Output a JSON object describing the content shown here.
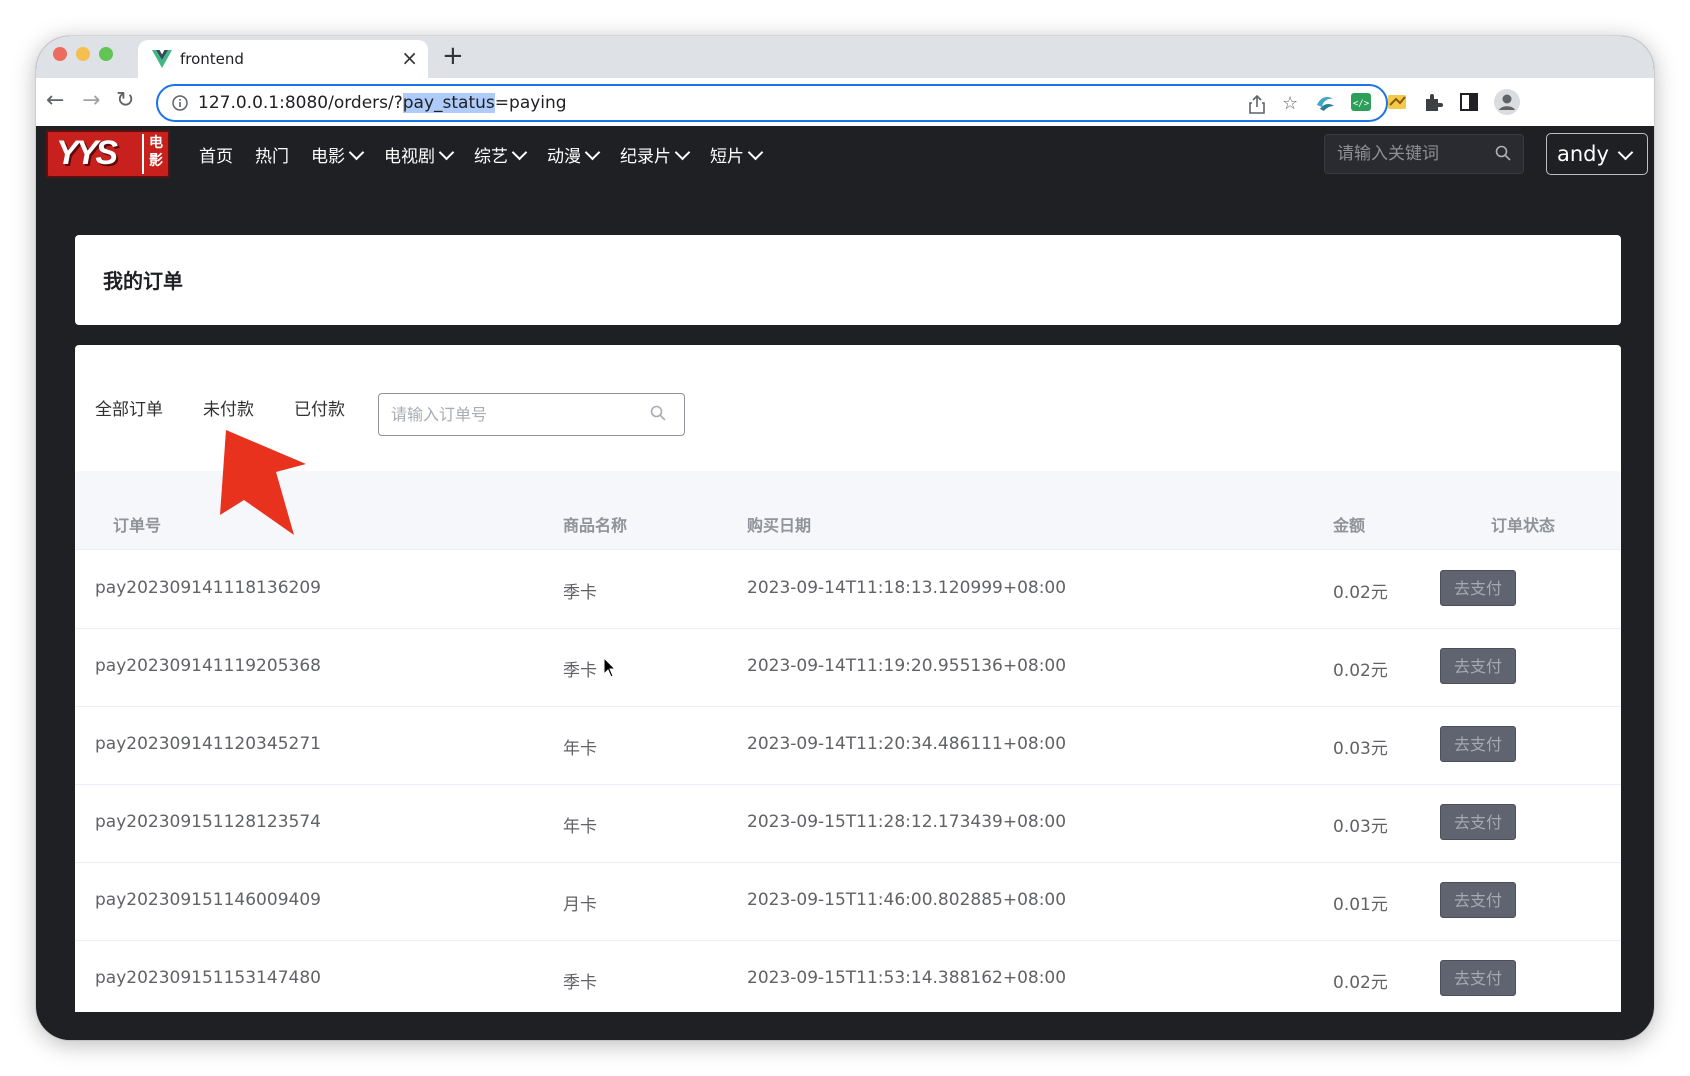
{
  "browser": {
    "tab_title": "frontend",
    "new_tab_label": "+",
    "url_prefix": "127.0.0.1:8080/orders/?",
    "url_selected": "pay_status",
    "url_suffix": "=paying"
  },
  "site": {
    "logo_text": "YYS",
    "logo_sub": "电影",
    "nav": [
      {
        "label": "首页",
        "dropdown": false
      },
      {
        "label": "热门",
        "dropdown": false
      },
      {
        "label": "电影",
        "dropdown": true
      },
      {
        "label": "电视剧",
        "dropdown": true
      },
      {
        "label": "综艺",
        "dropdown": true
      },
      {
        "label": "动漫",
        "dropdown": true
      },
      {
        "label": "纪录片",
        "dropdown": true
      },
      {
        "label": "短片",
        "dropdown": true
      }
    ],
    "search_placeholder": "请输入关键词",
    "user_name": "andy"
  },
  "page": {
    "title": "我的订单",
    "filters": {
      "all": "全部订单",
      "unpaid": "未付款",
      "paid": "已付款"
    },
    "order_search_placeholder": "请输入订单号",
    "columns": {
      "order_no": "订单号",
      "product": "商品名称",
      "date": "购买日期",
      "amount": "金额",
      "status": "订单状态"
    },
    "rows": [
      {
        "order_no": "pay202309141118136209",
        "product": "季卡",
        "date": "2023-09-14T11:18:13.120999+08:00",
        "amount": "0.02元",
        "action": "去支付"
      },
      {
        "order_no": "pay202309141119205368",
        "product": "季卡",
        "date": "2023-09-14T11:19:20.955136+08:00",
        "amount": "0.02元",
        "action": "去支付"
      },
      {
        "order_no": "pay202309141120345271",
        "product": "年卡",
        "date": "2023-09-14T11:20:34.486111+08:00",
        "amount": "0.03元",
        "action": "去支付"
      },
      {
        "order_no": "pay202309151128123574",
        "product": "年卡",
        "date": "2023-09-15T11:28:12.173439+08:00",
        "amount": "0.03元",
        "action": "去支付"
      },
      {
        "order_no": "pay202309151146009409",
        "product": "月卡",
        "date": "2023-09-15T11:46:00.802885+08:00",
        "amount": "0.01元",
        "action": "去支付"
      },
      {
        "order_no": "pay202309151153147480",
        "product": "季卡",
        "date": "2023-09-15T11:53:14.388162+08:00",
        "amount": "0.02元",
        "action": "去支付"
      }
    ]
  },
  "colors": {
    "header_bg": "#1f2024",
    "logo_red": "#c8201c",
    "annotation_arrow": "#e8321e",
    "pay_button": "#606470"
  }
}
